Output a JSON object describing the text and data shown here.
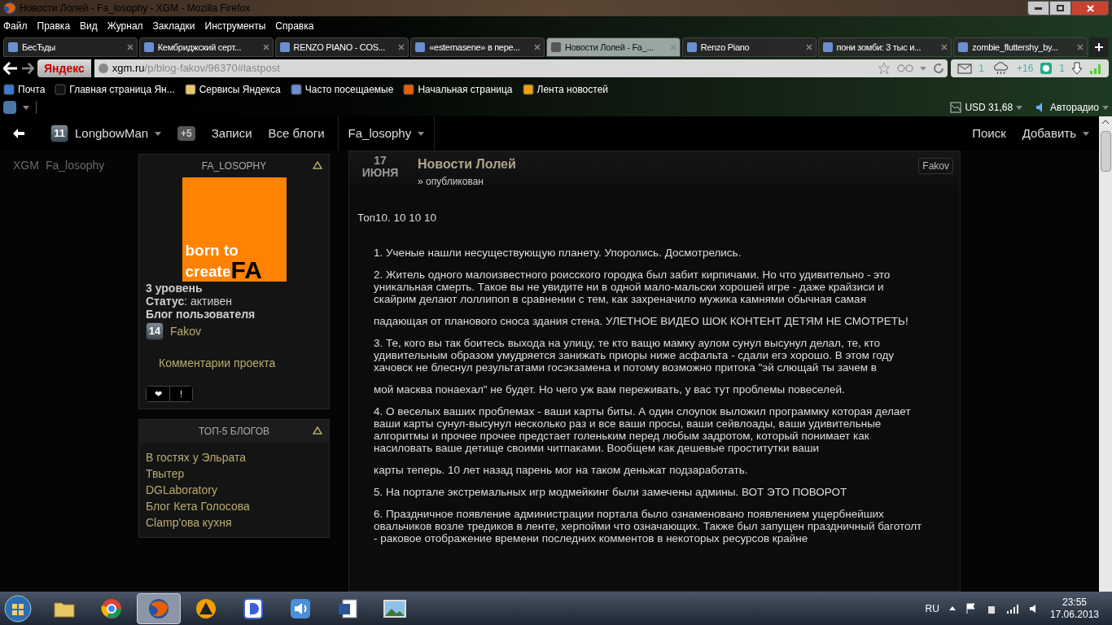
{
  "window": {
    "title": "Новости Лолей - Fa_losophy - XGM - Mozilla Firefox"
  },
  "menu": [
    "Файл",
    "Правка",
    "Вид",
    "Журнал",
    "Закладки",
    "Инструменты",
    "Справка"
  ],
  "tabs": [
    {
      "label": "БесЂды",
      "selected": false
    },
    {
      "label": "Кембриджский серт...",
      "selected": false
    },
    {
      "label": "RENZO PIANO - COS...",
      "selected": false
    },
    {
      "label": "«esternasene» в пере...",
      "selected": false
    },
    {
      "label": "Новости Лолей - Fa_...",
      "selected": true
    },
    {
      "label": "Renzo Piano",
      "selected": false
    },
    {
      "label": "пони зомби: 3 тыс и...",
      "selected": false
    },
    {
      "label": "zombie_fluttershy_by...",
      "selected": false
    }
  ],
  "navbar": {
    "search_logo": "Яндекс",
    "url_host": "xgm.ru",
    "url_path": "/p/blog-fakov/96370#lastpost",
    "mail_count": "1",
    "weather": "+16",
    "counter": "1"
  },
  "bookmarks": [
    "Почта",
    "Главная страница Ян...",
    "Сервисы Яндекса",
    "Часто посещаемые",
    "Начальная страница",
    "Лента новостей"
  ],
  "addon_bar": {
    "currency": "USD 31,68",
    "radio": "Авторадио"
  },
  "site_nav": {
    "user_level": "11",
    "user": "LongbowMan",
    "notifications": "+5",
    "links": [
      "Записи",
      "Все блоги"
    ],
    "blog": "Fa_losophy",
    "right_links": [
      "Поиск"
    ],
    "add": "Добавить"
  },
  "breadcrumb": [
    "XGM",
    "Fa_losophy"
  ],
  "blog_card": {
    "title": "FA_LOSOPHY",
    "logo": {
      "line1": "born to",
      "line2": "create",
      "mark": "FA"
    },
    "level": "3 уровень",
    "status_label": "Статус",
    "status": ": активен",
    "owner_label": "Блог пользователя",
    "owner_level": "14",
    "owner": "Fakov",
    "comments_link": "Комментарии проекта",
    "buttons": [
      "❤",
      "!"
    ]
  },
  "top_blogs": {
    "title": "ТОП-5 БЛОГОВ",
    "items": [
      "В гостях у Эльрата",
      "Твытер",
      "DGLaboratory",
      "Блог Кета Голосова",
      "Clamp'ова кухня"
    ]
  },
  "article": {
    "day": "17",
    "month": "ИЮНЯ",
    "title": "Новости Лолей",
    "status": "» опубликован",
    "author": "Fakov",
    "blocks": [
      {
        "kind": "lead",
        "text": "Топ10. 10 10 10"
      },
      {
        "kind": "item",
        "text": "1.  Ученые нашли несуществующую планету. Упоролись. Досмотрелись."
      },
      {
        "kind": "item",
        "text": "2.  Житель одного малоизвестного роисского городка был забит кирпичами. Но что удивительно - это уникальная смерть. Такое вы не увидите ни в одной мало-мальски хорошей игре - даже крайзиси и скайрим делают лоллипоп в сравнении с тем, как захреначило мужика камнями обычная самая"
      },
      {
        "kind": "item",
        "text": "падающая от планового сноса здания стена. УЛЕТНОЕ ВИДЕО ШОК КОНТЕНТ ДЕТЯМ НЕ СМОТРЕТЬ!"
      },
      {
        "kind": "item",
        "text": "3.  Те, кого вы так боитесь выхода на улицу, те кто ващю мамку аулом сунул высунул делал, те, кто удивительным образом умудряется занижать приоры ниже асфальта - сдали егэ хорошо. В этом году хачовск не блеснул результатами госэкзамена и потому возможно притока \"эй слющай ты зачем в"
      },
      {
        "kind": "item",
        "text": "мой масква понаехал\" не будет. Но чего уж вам переживать, у вас тут проблемы повеселей."
      },
      {
        "kind": "item",
        "text": "4.  О веселых ваших проблемах - ваши карты биты. А один слоупок выложил программку которая делает ваши карты сунул-высунул несколько раз и все ваши просы, ваши сейвлоады, ваши удивительные алгоритмы и прочее прочее предстает голеньким перед любым задротом, который понимает как насиловать ваше детище своими читпаками. Вообщем как дешевые проститутки ваши"
      },
      {
        "kind": "item",
        "text": "карты теперь. 10 лет назад парень мог на таком деньжат подзаработать."
      },
      {
        "kind": "item",
        "text": "5.  На портале экстремальных игр модмейкинг были замечены админы. ВОТ ЭТО ПОВОРОТ"
      },
      {
        "kind": "item",
        "text": "6.  Праздничное появление администрации портала было ознаменовано появлением ущербнейших овальчиков возле тредиков в ленте, херпойми что означающих. Также был запущен праздничный баготолт - раковое отображение времени последних комментов в некоторых ресурсов крайне"
      }
    ]
  },
  "taskbar": {
    "apps": [
      {
        "selected": false
      },
      {
        "selected": false
      },
      {
        "selected": true
      },
      {
        "selected": false
      },
      {
        "selected": false
      },
      {
        "selected": false
      },
      {
        "selected": false
      },
      {
        "selected": false
      }
    ],
    "language": "RU",
    "time": "23:55",
    "date": "17.06.2013"
  }
}
